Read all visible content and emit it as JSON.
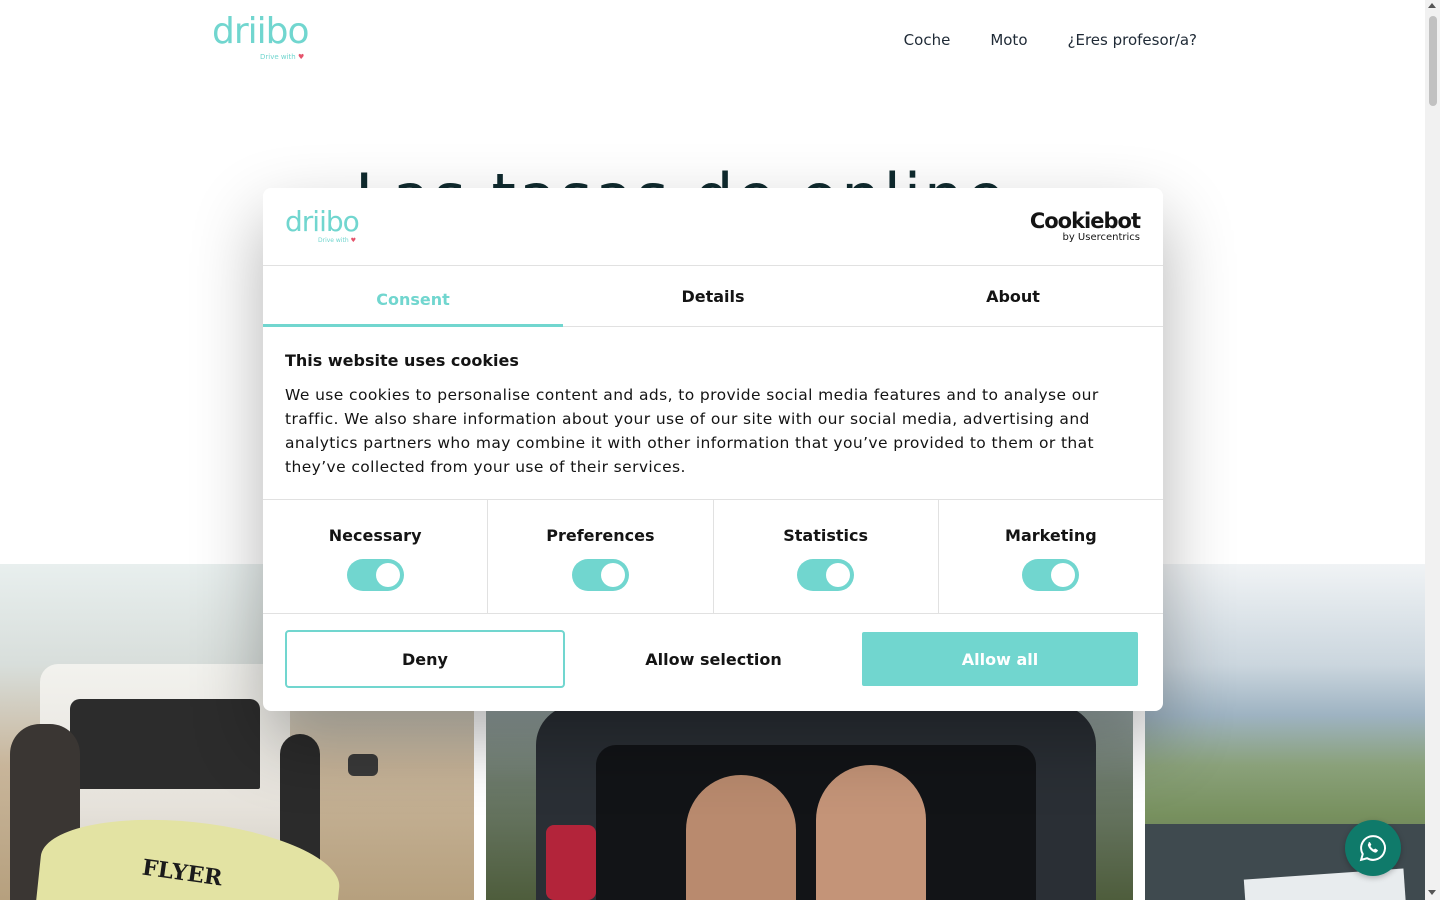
{
  "brand": {
    "name": "driibo",
    "tagline": "Drive with",
    "accent": "#71d6cf",
    "heart": "#e5536b"
  },
  "nav": {
    "items": [
      "Coche",
      "Moto",
      "¿Eres profesor/a?"
    ]
  },
  "hero": {
    "title": "Las tasas de online"
  },
  "photos": {
    "beach_board_text": "FLYER"
  },
  "whatsapp": {
    "icon": "whatsapp-icon",
    "color": "#0f7a6a"
  },
  "cookie_dialog": {
    "provider": {
      "name": "Cookiebot",
      "by": "by Usercentrics"
    },
    "tabs": [
      {
        "label": "Consent",
        "active": true
      },
      {
        "label": "Details",
        "active": false
      },
      {
        "label": "About",
        "active": false
      }
    ],
    "heading": "This website uses cookies",
    "text": "We use cookies to personalise content and ads, to provide social media features and to analyse our traffic. We also share information about your use of our site with our social media, advertising and analytics partners who may combine it with other information that you’ve provided to them or that they’ve collected from your use of their services.",
    "categories": [
      {
        "label": "Necessary",
        "on": true
      },
      {
        "label": "Preferences",
        "on": true
      },
      {
        "label": "Statistics",
        "on": true
      },
      {
        "label": "Marketing",
        "on": true
      }
    ],
    "buttons": {
      "deny": "Deny",
      "selection": "Allow selection",
      "allow_all": "Allow all"
    }
  }
}
